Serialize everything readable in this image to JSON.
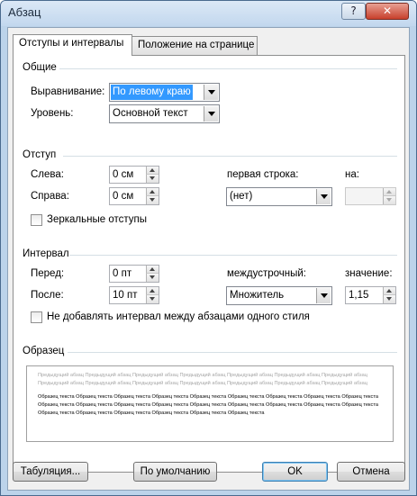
{
  "window": {
    "title": "Абзац",
    "help_label": "?",
    "close_label": "✕"
  },
  "tabs": [
    {
      "label": "Отступы и интервалы",
      "active": true
    },
    {
      "label": "Положение на странице",
      "active": false
    }
  ],
  "general": {
    "label": "Общие",
    "alignment": {
      "label": "Выравнивание:",
      "value": "По левому краю"
    },
    "level": {
      "label": "Уровень:",
      "value": "Основной текст"
    }
  },
  "indent": {
    "label": "Отступ",
    "left": {
      "label": "Слева:",
      "value": "0 см"
    },
    "right": {
      "label": "Справа:",
      "value": "0 см"
    },
    "first_line": {
      "label": "первая строка:",
      "value": "(нет)"
    },
    "by": {
      "label": "на:",
      "value": ""
    },
    "mirror": {
      "label": "Зеркальные отступы",
      "checked": false
    }
  },
  "spacing": {
    "label": "Интервал",
    "before": {
      "label": "Перед:",
      "value": "0 пт"
    },
    "after": {
      "label": "После:",
      "value": "10 пт"
    },
    "line_spacing": {
      "label": "междустрочный:",
      "value": "Множитель"
    },
    "at": {
      "label": "значение:",
      "value": "1,15"
    },
    "no_space": {
      "label": "Не добавлять интервал между абзацами одного стиля",
      "checked": false
    }
  },
  "preview": {
    "label": "Образец",
    "previous_paragraph": "Предыдущий абзац Предыдущий абзац Предыдущий абзац Предыдущий абзац Предыдущий абзац Предыдущий абзац Предыдущий абзац Предыдущий абзац Предыдущий абзац Предыдущий абзац Предыдущий абзац Предыдущий абзац Предыдущий абзац Предыдущий абзац",
    "sample_text": "Образец текста Образец текста Образец текста Образец текста Образец текста Образец текста Образец текста Образец текста Образец текста Образец текста Образец текста Образец текста Образец текста Образец текста Образец текста Образец текста Образец текста Образец текста Образец текста Образец текста Образец текста Образец текста Образец текста Образец текста"
  },
  "buttons": {
    "tabs": "Табуляция...",
    "default": "По умолчанию",
    "ok": "OK",
    "cancel": "Отмена"
  }
}
